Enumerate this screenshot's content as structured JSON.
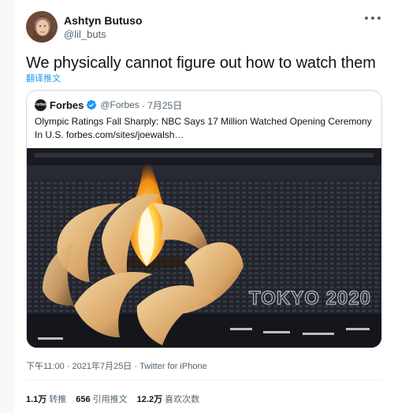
{
  "author": {
    "name": "Ashtyn Butuso",
    "handle": "@lil_buts"
  },
  "tweet": {
    "text": "We physically cannot figure out how to watch them",
    "translate_label": "翻译推文"
  },
  "quote": {
    "logo_text": "Forbes",
    "name": "Forbes",
    "handle": "@Forbes",
    "date": "· 7月25日",
    "text": "Olympic Ratings Fall Sharply: NBC Says 17 Million Watched Opening Ceremony In U.S. forbes.com/sites/joewalsh…",
    "image_caption": "TOKYO 2020"
  },
  "meta": {
    "timestamp": "下午11:00 · 2021年7月25日 · ",
    "source": "Twitter for iPhone"
  },
  "stats": {
    "retweets_count": "1.1万",
    "retweets_label": "转推",
    "quotes_count": "656",
    "quotes_label": "引用推文",
    "likes_count": "12.2万",
    "likes_label": "喜欢次数"
  },
  "colors": {
    "accent": "#1d9bf0",
    "text_primary": "#0f1419",
    "text_secondary": "#536471",
    "border": "#cfd9de"
  }
}
